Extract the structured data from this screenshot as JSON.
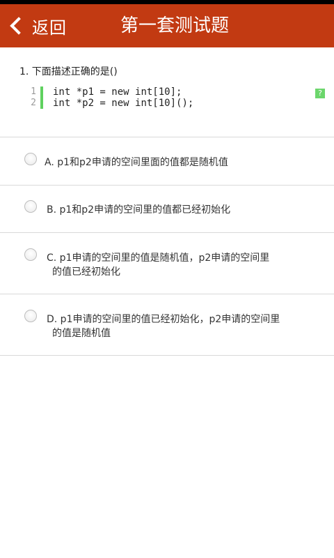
{
  "header": {
    "back_label": "返回",
    "title": "第一套测试题"
  },
  "question": {
    "text": "1. 下面描述正确的是()",
    "code_lines": [
      {
        "num": "1",
        "pre": "int *p1 = ",
        "kw": "new",
        "post": " int[10];"
      },
      {
        "num": "2",
        "pre": "int *p2 = ",
        "kw": "new",
        "post": " int[10]();"
      }
    ],
    "help_badge": "?"
  },
  "options": [
    {
      "line1": "A. p1和p2申请的空间里面的值都是随机值",
      "line2": ""
    },
    {
      "line1": "B. p1和p2申请的空间里的值都已经初始化",
      "line2": ""
    },
    {
      "line1": "C. p1申请的空间里的值是随机值，p2申请的空间里",
      "line2": "的值已经初始化"
    },
    {
      "line1": "D. p1申请的空间里的值已经初始化，p2申请的空间里",
      "line2": "的值是随机值"
    }
  ],
  "colors": {
    "appbar": "#c23a12",
    "code_keyword": "#1f78a8",
    "code_bar": "#5fd15f"
  }
}
